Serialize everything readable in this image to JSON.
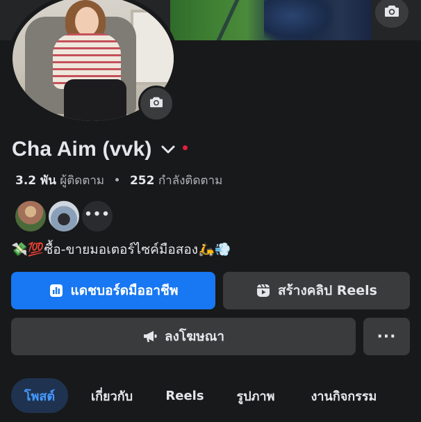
{
  "profile": {
    "name": "Cha Aim (vvk)",
    "followers_count": "3.2 พัน",
    "followers_label": "ผู้ติดตาม",
    "separator": "•",
    "following_count": "252",
    "following_label": "กำลังติดตาม",
    "bio": "💸💯ซื้อ-ขายมอเตอร์ไซค์มือสอง🛵💨",
    "mutual_more": "•••"
  },
  "actions": {
    "dashboard_label": "แดชบอร์ดมืออาชีพ",
    "create_reels_label": "สร้างคลิป Reels",
    "advertise_label": "ลงโฆษณา",
    "more_label": "···"
  },
  "tabs": [
    {
      "label": "โพสต์",
      "active": true
    },
    {
      "label": "เกี่ยวกับ",
      "active": false
    },
    {
      "label": "Reels",
      "active": false
    },
    {
      "label": "รูปภาพ",
      "active": false
    },
    {
      "label": "งานกิจกรรม",
      "active": false
    }
  ],
  "icons": {
    "cover_camera": "camera-icon",
    "avatar_camera": "camera-icon",
    "name_dropdown": "chevron-down-icon",
    "dashboard": "bar-chart-icon",
    "reels": "reels-icon",
    "advertise": "megaphone-icon"
  },
  "colors": {
    "background": "#18191a",
    "primary_button": "#1877f2",
    "secondary_button": "#3a3b3c",
    "active_tab_bg": "#1f3350",
    "active_tab_text": "#4599ff",
    "online_dot": "#e41e3f",
    "text_primary": "#e4e6eb",
    "text_secondary": "#b0b3b8"
  }
}
